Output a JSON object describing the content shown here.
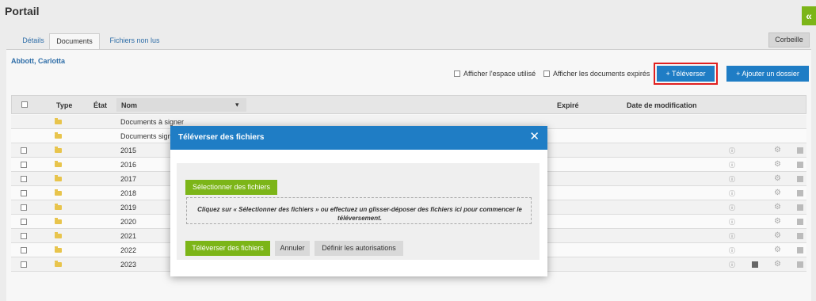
{
  "header": {
    "title": "Portail",
    "collapse_glyph": "«"
  },
  "tabs": [
    {
      "label": "Détails"
    },
    {
      "label": "Documents"
    },
    {
      "label": "Fichiers non lus"
    }
  ],
  "trash_label": "Corbeille",
  "owner_name": "Abbott, Carlotta",
  "options": {
    "show_space_label": "Afficher l'espace utilisé",
    "show_expired_label": "Afficher les documents expirés"
  },
  "actions": {
    "upload_label": "+ Téléverser",
    "add_folder_label": "+ Ajouter un dossier"
  },
  "table": {
    "headers": {
      "type": "Type",
      "state": "État",
      "name": "Nom",
      "expired": "Expiré",
      "modified": "Date de modification"
    },
    "sort_glyph": "▾",
    "rows": [
      {
        "name": "Documents à signer"
      },
      {
        "name": "Documents signés"
      },
      {
        "name": "2015"
      },
      {
        "name": "2016"
      },
      {
        "name": "2017"
      },
      {
        "name": "2018"
      },
      {
        "name": "2019"
      },
      {
        "name": "2020"
      },
      {
        "name": "2021"
      },
      {
        "name": "2022"
      },
      {
        "name": "2023"
      }
    ]
  },
  "modal": {
    "title": "Téléverser des fichiers",
    "close_glyph": "✕",
    "select_files_label": "Sélectionner des fichiers",
    "dropzone_text": "Cliquez sur « Sélectionner des fichiers » ou effectuez un glisser-déposer des fichiers ici pour commencer le téléversement.",
    "upload_files_label": "Téléverser des fichiers",
    "cancel_label": "Annuler",
    "permissions_label": "Définir les autorisations"
  },
  "icons": {
    "info": "ⓘ",
    "gear": "⚙"
  },
  "colors": {
    "accent_blue": "#1f7dc5",
    "accent_green": "#7cb518",
    "highlight_red": "#e02020"
  }
}
